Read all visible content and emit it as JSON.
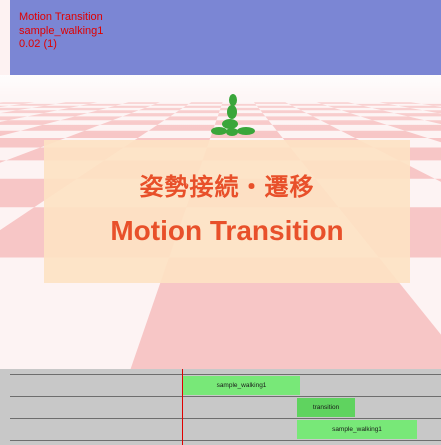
{
  "hud": {
    "title": "Motion Transition",
    "motion_name": "sample_walking1",
    "time_readout": "0.02 (1)"
  },
  "overlay": {
    "title_jp": "姿勢接続・遷移",
    "title_en": "Motion Transition"
  },
  "timeline": {
    "clips": [
      {
        "label": "sample_walking1",
        "color": "#78e878"
      },
      {
        "label": "transition",
        "color": "#5fd35f"
      },
      {
        "label": "sample_walking1",
        "color": "#78e878"
      }
    ]
  },
  "colors": {
    "sky": "#7b86d4",
    "floor_pink": "#f7c6c6",
    "floor_white": "#fdf3f3",
    "character": "#3aa63a",
    "playhead": "#e00000",
    "overlay_text": "#e8502a"
  }
}
